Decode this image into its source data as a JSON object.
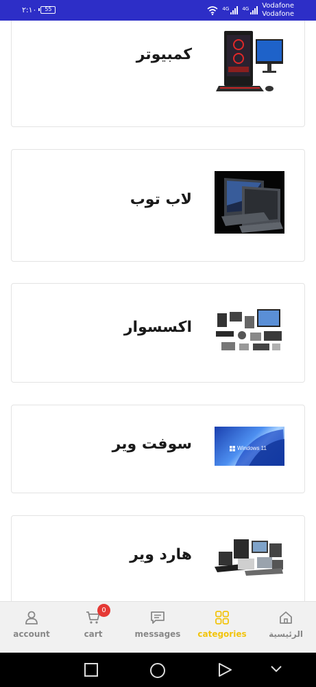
{
  "status_bar": {
    "time": "٢:١٠",
    "battery": "55",
    "network_1": "4G",
    "network_2": "4G",
    "carrier_1": "Vodafone",
    "carrier_2": "Vodafone",
    "icons": [
      "wifi-icon",
      "signal-icon",
      "signal-icon",
      "battery-icon"
    ]
  },
  "categories": [
    {
      "title": "كمبيوتر",
      "image": "desktop-computer-image"
    },
    {
      "title": "لاب توب",
      "image": "laptop-image"
    },
    {
      "title": "اكسسوار",
      "image": "accessories-image"
    },
    {
      "title": "سوفت وير",
      "image": "windows-software-image",
      "image_text": "Windows 11"
    },
    {
      "title": "هارد وير",
      "image": "hardware-image"
    }
  ],
  "bottom_nav": {
    "items": [
      {
        "label": "account",
        "icon": "user-icon",
        "active": false
      },
      {
        "label": "cart",
        "icon": "cart-icon",
        "active": false,
        "badge": "0"
      },
      {
        "label": "messages",
        "icon": "message-icon",
        "active": false
      },
      {
        "label": "categories",
        "icon": "grid-icon",
        "active": true
      },
      {
        "label": "الرئيسية",
        "icon": "home-icon",
        "active": false
      }
    ],
    "active_color": "#f2c40d",
    "inactive_color": "#888888"
  },
  "system_nav": {
    "buttons": [
      "recent-apps-icon",
      "home-circle-icon",
      "back-icon",
      "hide-keyboard-icon"
    ]
  },
  "colors": {
    "status_bar": "#2d2ec7",
    "badge": "#e53935"
  }
}
